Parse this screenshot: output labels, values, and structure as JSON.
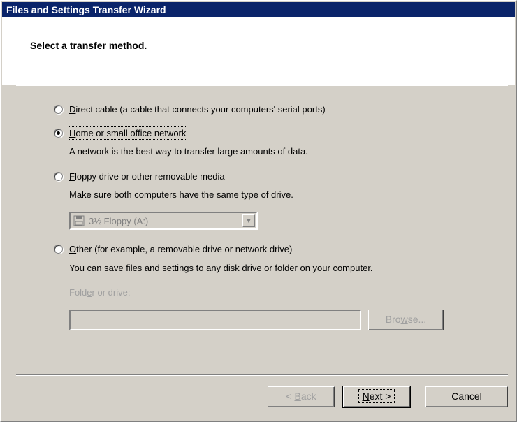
{
  "window": {
    "title": "Files and Settings Transfer Wizard"
  },
  "header": {
    "title": "Select a transfer method."
  },
  "options": [
    {
      "mnemonic": "D",
      "label_rest": "irect cable (a cable that connects your computers' serial ports)",
      "selected": false
    },
    {
      "mnemonic": "H",
      "label_rest": "ome or small office network",
      "selected": true,
      "description": "A network is the best way to transfer large amounts of data."
    },
    {
      "mnemonic": "F",
      "label_rest": "loppy drive or other removable media",
      "selected": false,
      "description": "Make sure both computers have the same type of drive."
    },
    {
      "mnemonic": "O",
      "label_rest": "ther (for example, a removable drive or network drive)",
      "selected": false,
      "description": "You can save files and settings to any disk drive or folder on your computer."
    }
  ],
  "drive_select": {
    "value": "3½ Floppy (A:)",
    "icon": "floppy-disk-icon",
    "enabled": false
  },
  "folder": {
    "label_pre": "Fold",
    "label_mnemonic": "e",
    "label_post": "r or drive:",
    "value": "",
    "enabled": false
  },
  "buttons": {
    "browse": {
      "pre": "Bro",
      "mnemonic": "w",
      "post": "se...",
      "enabled": false
    },
    "back": {
      "pre": "< ",
      "mnemonic": "B",
      "post": "ack",
      "enabled": false
    },
    "next": {
      "pre": "",
      "mnemonic": "N",
      "post": "ext >",
      "enabled": true
    },
    "cancel": {
      "label": "Cancel",
      "enabled": true
    }
  },
  "colors": {
    "title_bar": "#0a246a",
    "face": "#d4d0c8",
    "disabled_text": "#a0a0a0"
  }
}
